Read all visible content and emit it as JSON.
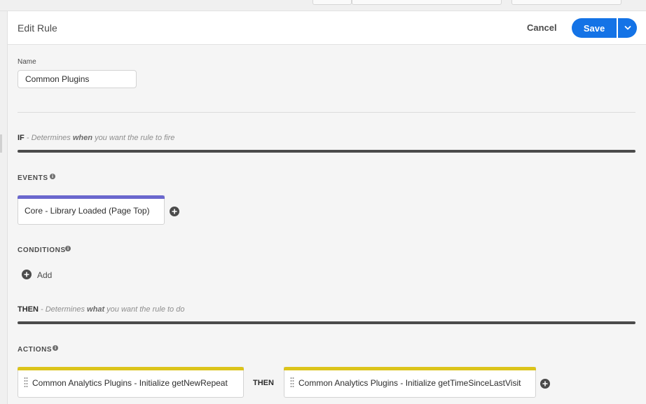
{
  "header": {
    "title": "Edit Rule",
    "cancel_label": "Cancel",
    "save_label": "Save"
  },
  "name_field": {
    "label": "Name",
    "value": "Common Plugins"
  },
  "if_section": {
    "keyword": "IF",
    "desc_prefix": "- Determines",
    "desc_emph": "when",
    "desc_suffix": "you want the rule to fire"
  },
  "events": {
    "heading": "EVENTS",
    "items": [
      {
        "label": "Core - Library Loaded (Page Top)",
        "accent": "#6a67ce"
      }
    ]
  },
  "conditions": {
    "heading": "CONDITIONS",
    "add_label": "Add"
  },
  "then_section": {
    "keyword": "THEN",
    "desc_prefix": "- Determines",
    "desc_emph": "what",
    "desc_suffix": "you want the rule to do"
  },
  "actions": {
    "heading": "ACTIONS",
    "connector": "THEN",
    "items": [
      {
        "label": "Common Analytics Plugins - Initialize getNewRepeat",
        "accent": "#dcc41a"
      },
      {
        "label": "Common Analytics Plugins - Initialize getTimeSinceLastVisit",
        "accent": "#dcc41a"
      }
    ]
  },
  "colors": {
    "primary": "#1473e6",
    "event_accent": "#6a67ce",
    "action_accent": "#dcc41a"
  },
  "icons": [
    "chevron-down-icon",
    "info-icon",
    "plus-circle-icon",
    "drag-handle-icon"
  ]
}
